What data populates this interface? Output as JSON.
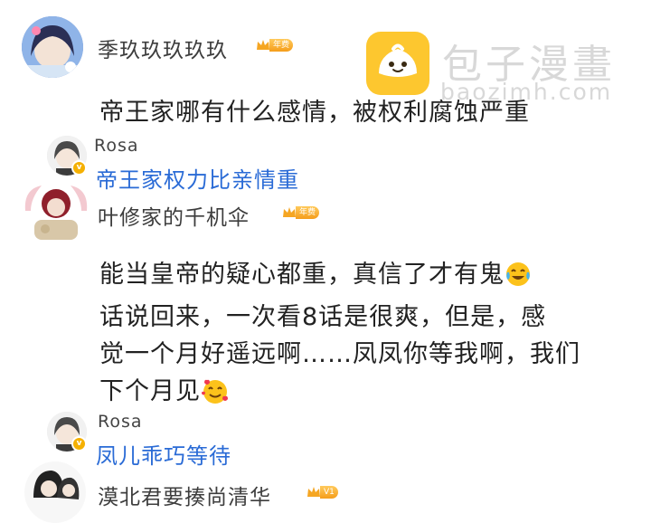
{
  "watermark": {
    "brand": "包子漫畫",
    "url": "baozimh.com"
  },
  "comments": [
    {
      "username": "季玖玖玖玖玖",
      "badge": "年费",
      "lines": [
        "帝王家哪有什么感情，被权利腐蚀严重"
      ],
      "reply": {
        "username": "Rosa",
        "text": "帝王家权力比亲情重"
      }
    },
    {
      "username": "叶修家的千机伞",
      "badge": "年费",
      "lines": [
        "能当皇帝的疑心都重，真信了才有鬼",
        "话说回来，一次看8话是很爽，但是，感",
        "觉一个月好遥远啊……凤凤你等我啊，我们",
        "下个月见"
      ],
      "reply": {
        "username": "Rosa",
        "text": "凤儿乖巧等待"
      }
    },
    {
      "username": "漠北君要揍尚清华",
      "badge": "V1",
      "lines": []
    }
  ],
  "icons": {
    "crown": "crown-icon",
    "verified": "verified-v-icon",
    "laugh_emoji": "tears-of-joy-emoji",
    "love_emoji": "smiling-face-with-hearts-emoji",
    "logo": "baozi-bun-logo-icon"
  },
  "colors": {
    "reply_text": "#2a6bd6",
    "badge": "#f5a623",
    "logo_bg": "#fdc72f"
  }
}
